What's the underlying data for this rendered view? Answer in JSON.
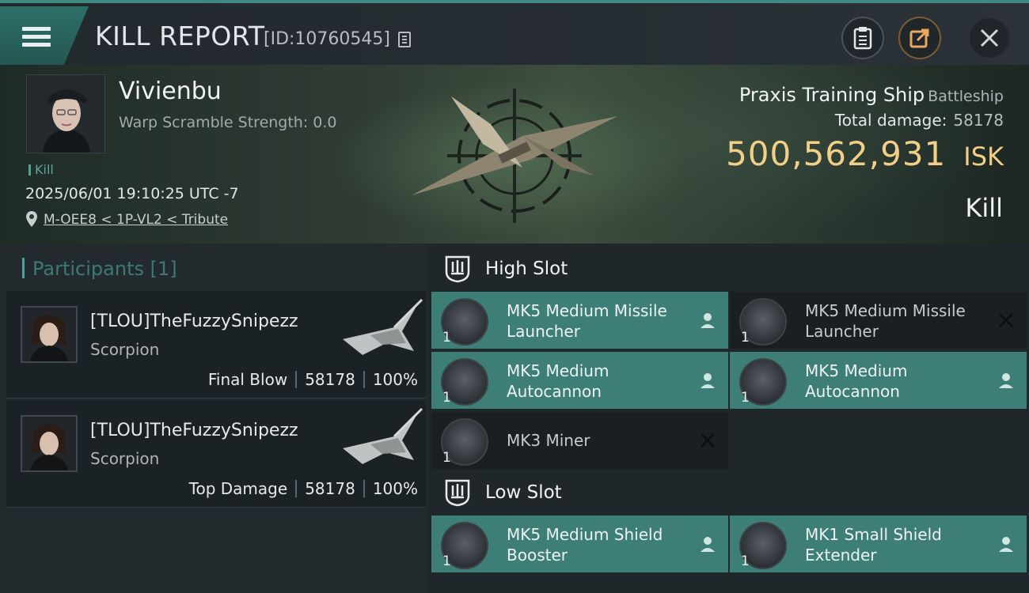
{
  "header": {
    "title": "KILL REPORT",
    "report_id": "[ID:10760545]",
    "buttons": [
      "clipboard-icon",
      "share-icon",
      "close-icon"
    ]
  },
  "victim": {
    "name": "Vivienbu",
    "warp_scramble": "Warp Scramble Strength: 0.0",
    "kill_tag": "Kill",
    "datetime": "2025/06/01 19:10:25 UTC -7",
    "location": "M-OEE8 < 1P-VL2 < Tribute"
  },
  "ship": {
    "name": "Praxis Training Ship",
    "class": "Battleship",
    "total_damage_label": "Total damage:",
    "total_damage": "58178",
    "isk_value": "500,562,931",
    "isk_unit": "ISK",
    "result": "Kill"
  },
  "participants": {
    "header": "Participants [1]",
    "items": [
      {
        "name": "[TLOU]TheFuzzySnipezz",
        "ship": "Scorpion",
        "role": "Final Blow",
        "damage": "58178",
        "percent": "100%"
      },
      {
        "name": "[TLOU]TheFuzzySnipezz",
        "ship": "Scorpion",
        "role": "Top Damage",
        "damage": "58178",
        "percent": "100%"
      }
    ]
  },
  "fitting": {
    "high_slot_label": "High Slot",
    "low_slot_label": "Low Slot",
    "high": [
      {
        "name": "MK5 Medium Missile Launcher",
        "qty": "1",
        "state": "fitted",
        "status_icon": "person-icon"
      },
      {
        "name": "MK5 Medium Missile Launcher",
        "qty": "1",
        "state": "destroyed",
        "status_icon": "x-icon"
      },
      {
        "name": "MK5 Medium Autocannon",
        "qty": "1",
        "state": "fitted",
        "status_icon": "person-icon"
      },
      {
        "name": "MK5 Medium Autocannon",
        "qty": "1",
        "state": "fitted",
        "status_icon": "person-icon"
      },
      {
        "name": "MK3 Miner",
        "qty": "1",
        "state": "destroyed",
        "status_icon": "x-icon"
      }
    ],
    "low": [
      {
        "name": "MK5 Medium Shield Booster",
        "qty": "1",
        "state": "fitted",
        "status_icon": "person-icon"
      },
      {
        "name": "MK1 Small Shield Extender",
        "qty": "1",
        "state": "fitted",
        "status_icon": "person-icon"
      }
    ]
  },
  "colors": {
    "accent_teal": "#3d7f76",
    "isk_gold": "#f2cf86",
    "background": "#1b2024"
  }
}
